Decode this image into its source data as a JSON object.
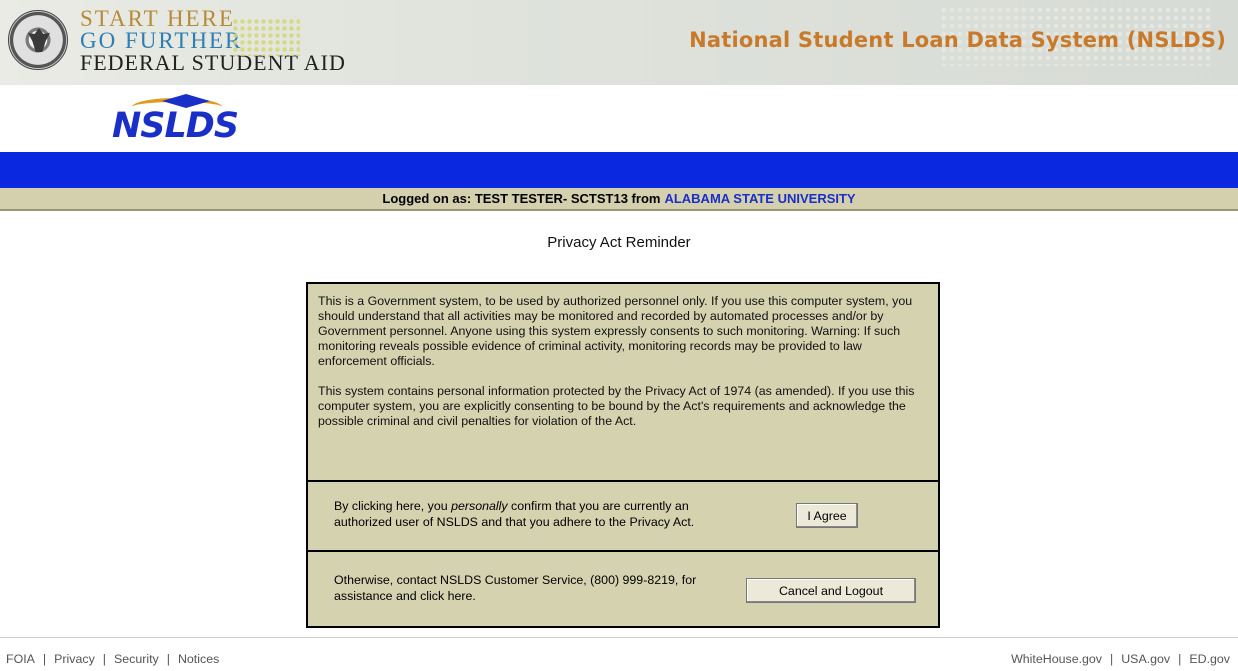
{
  "header": {
    "fsa_line1": "START HERE",
    "fsa_line2": "GO FURTHER",
    "fsa_line3": "FEDERAL STUDENT AID",
    "site_title": "National Student Loan Data System (NSLDS)",
    "logo_text": "NSLDS"
  },
  "login": {
    "prefix": "Logged on as: TEST TESTER- SCTST13 from",
    "institution": "ALABAMA STATE UNIVERSITY"
  },
  "page_title": "Privacy Act Reminder",
  "notice": {
    "paragraph1": "This is a Government system, to be used by authorized personnel only. If you use this computer system, you should understand that all activities may be monitored and recorded by automated processes and/or by Government personnel. Anyone using this system expressly consents to such monitoring. Warning: If such monitoring reveals possible evidence of criminal activity, monitoring records may be provided to law enforcement officials.",
    "paragraph2": "This system contains personal information protected by the Privacy Act of 1974 (as amended). If you use this computer system, you are explicitly consenting to be bound by the Act's requirements and acknowledge the possible criminal and civil penalties for violation of the Act."
  },
  "agree": {
    "text_before": "By clicking here, you",
    "text_emphasis": "personally",
    "text_after": "confirm that you are currently an authorized user of NSLDS and that you adhere to the Privacy Act.",
    "button_label": "I Agree"
  },
  "cancel": {
    "text": "Otherwise, contact NSLDS Customer Service, (800) 999-8219, for assistance and click here.",
    "button_label": "Cancel and Logout"
  },
  "footer": {
    "left_links": [
      "FOIA",
      "Privacy",
      "Security",
      "Notices"
    ],
    "right_links": [
      "WhiteHouse.gov",
      "USA.gov",
      "ED.gov"
    ]
  },
  "colors": {
    "blue_bar": "#0a28e0",
    "tan": "#d5d2b0",
    "title_orange": "#c87a2a",
    "institution_blue": "#1a2fc7"
  }
}
